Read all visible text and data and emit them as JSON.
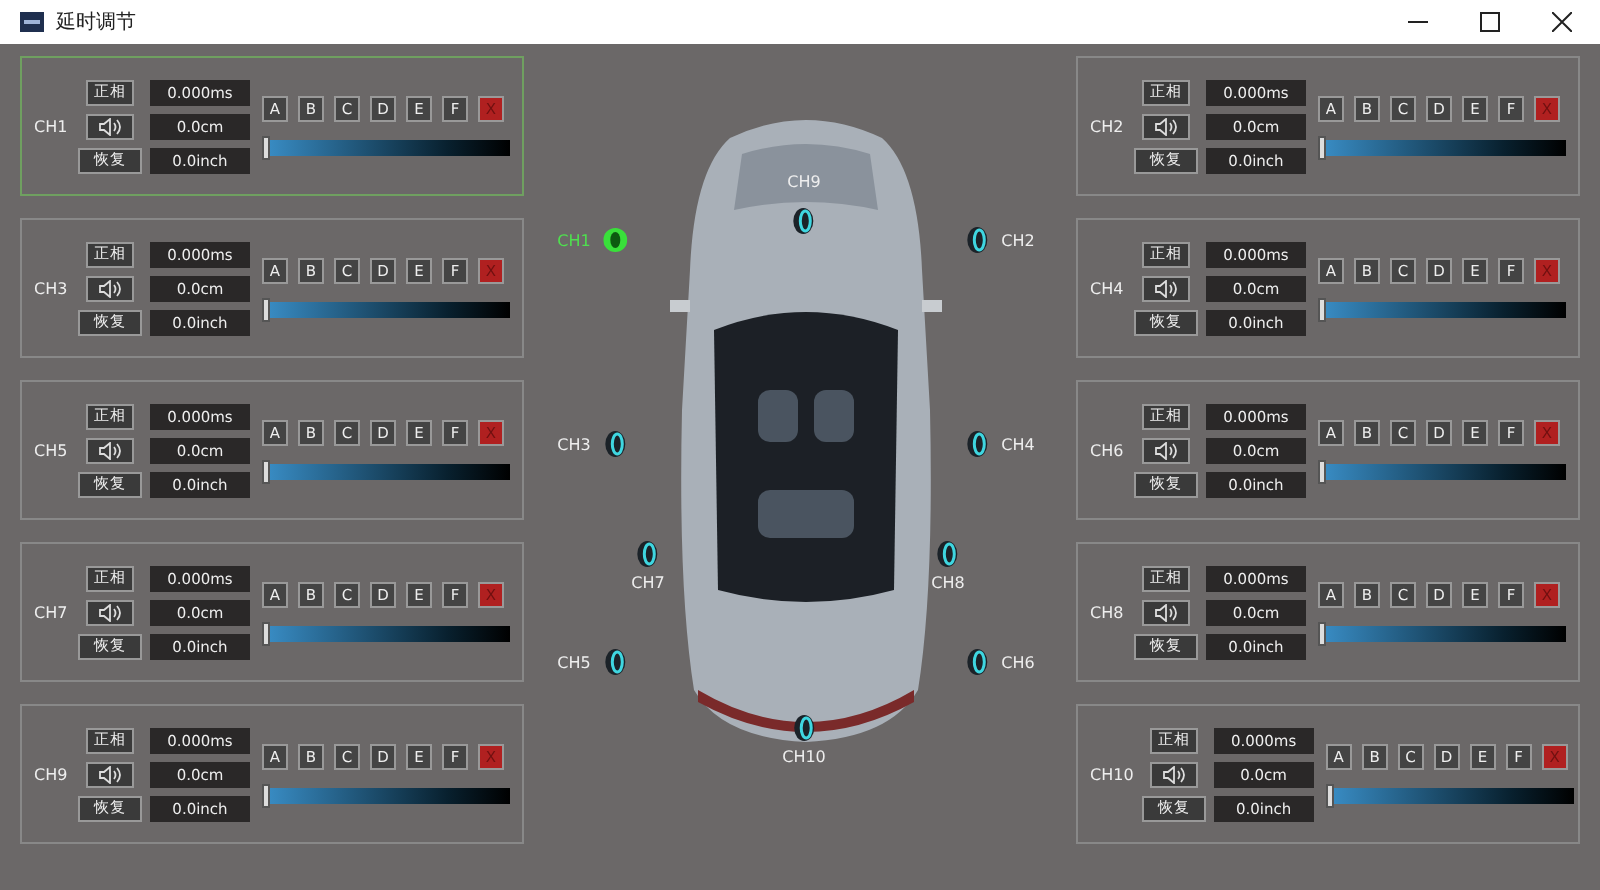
{
  "window": {
    "title": "延时调节"
  },
  "channels": [
    {
      "name": "CH1",
      "selected": true,
      "phase": "正相",
      "reset": "恢复",
      "delay_ms": "0.000ms",
      "delay_cm": "0.0cm",
      "delay_inch": "0.0inch",
      "presets": [
        "A",
        "B",
        "C",
        "D",
        "E",
        "F"
      ],
      "clear": "X",
      "level": 0
    },
    {
      "name": "CH2",
      "selected": false,
      "phase": "正相",
      "reset": "恢复",
      "delay_ms": "0.000ms",
      "delay_cm": "0.0cm",
      "delay_inch": "0.0inch",
      "presets": [
        "A",
        "B",
        "C",
        "D",
        "E",
        "F"
      ],
      "clear": "X",
      "level": 0
    },
    {
      "name": "CH3",
      "selected": false,
      "phase": "正相",
      "reset": "恢复",
      "delay_ms": "0.000ms",
      "delay_cm": "0.0cm",
      "delay_inch": "0.0inch",
      "presets": [
        "A",
        "B",
        "C",
        "D",
        "E",
        "F"
      ],
      "clear": "X",
      "level": 0
    },
    {
      "name": "CH4",
      "selected": false,
      "phase": "正相",
      "reset": "恢复",
      "delay_ms": "0.000ms",
      "delay_cm": "0.0cm",
      "delay_inch": "0.0inch",
      "presets": [
        "A",
        "B",
        "C",
        "D",
        "E",
        "F"
      ],
      "clear": "X",
      "level": 0
    },
    {
      "name": "CH5",
      "selected": false,
      "phase": "正相",
      "reset": "恢复",
      "delay_ms": "0.000ms",
      "delay_cm": "0.0cm",
      "delay_inch": "0.0inch",
      "presets": [
        "A",
        "B",
        "C",
        "D",
        "E",
        "F"
      ],
      "clear": "X",
      "level": 0
    },
    {
      "name": "CH6",
      "selected": false,
      "phase": "正相",
      "reset": "恢复",
      "delay_ms": "0.000ms",
      "delay_cm": "0.0cm",
      "delay_inch": "0.0inch",
      "presets": [
        "A",
        "B",
        "C",
        "D",
        "E",
        "F"
      ],
      "clear": "X",
      "level": 0
    },
    {
      "name": "CH7",
      "selected": false,
      "phase": "正相",
      "reset": "恢复",
      "delay_ms": "0.000ms",
      "delay_cm": "0.0cm",
      "delay_inch": "0.0inch",
      "presets": [
        "A",
        "B",
        "C",
        "D",
        "E",
        "F"
      ],
      "clear": "X",
      "level": 0
    },
    {
      "name": "CH8",
      "selected": false,
      "phase": "正相",
      "reset": "恢复",
      "delay_ms": "0.000ms",
      "delay_cm": "0.0cm",
      "delay_inch": "0.0inch",
      "presets": [
        "A",
        "B",
        "C",
        "D",
        "E",
        "F"
      ],
      "clear": "X",
      "level": 0
    },
    {
      "name": "CH9",
      "selected": false,
      "phase": "正相",
      "reset": "恢复",
      "delay_ms": "0.000ms",
      "delay_cm": "0.0cm",
      "delay_inch": "0.0inch",
      "presets": [
        "A",
        "B",
        "C",
        "D",
        "E",
        "F"
      ],
      "clear": "X",
      "level": 0
    },
    {
      "name": "CH10",
      "selected": false,
      "phase": "正相",
      "reset": "恢复",
      "delay_ms": "0.000ms",
      "delay_cm": "0.0cm",
      "delay_inch": "0.0inch",
      "presets": [
        "A",
        "B",
        "C",
        "D",
        "E",
        "F"
      ],
      "clear": "X",
      "level": 0
    }
  ],
  "speakers": [
    {
      "label": "CH9",
      "selected": false
    },
    {
      "label": "CH1",
      "selected": true
    },
    {
      "label": "CH2",
      "selected": false
    },
    {
      "label": "CH3",
      "selected": false
    },
    {
      "label": "CH4",
      "selected": false
    },
    {
      "label": "CH7",
      "selected": false
    },
    {
      "label": "CH8",
      "selected": false
    },
    {
      "label": "CH5",
      "selected": false
    },
    {
      "label": "CH6",
      "selected": false
    },
    {
      "label": "CH10",
      "selected": false
    }
  ]
}
